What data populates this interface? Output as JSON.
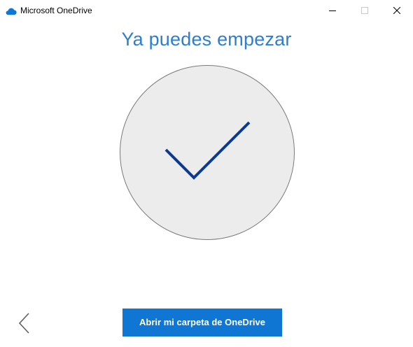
{
  "window": {
    "title": "Microsoft OneDrive",
    "icon": "onedrive-cloud-icon",
    "controls": [
      "minimize-icon",
      "maximize-icon",
      "close-icon"
    ]
  },
  "main": {
    "heading": "Ya puedes empezar",
    "illustration": "checkmark-icon"
  },
  "footer": {
    "back_icon": "chevron-left-icon",
    "primary_button_label": "Abrir mi carpeta de OneDrive"
  },
  "colors": {
    "heading": "#2b7fd1",
    "primary_button": "#0f76d4",
    "checkmark": "#0b3a8f",
    "circle_fill": "#ececec",
    "circle_stroke": "#7a7a7a",
    "onedrive_icon": "#0f78d4"
  }
}
